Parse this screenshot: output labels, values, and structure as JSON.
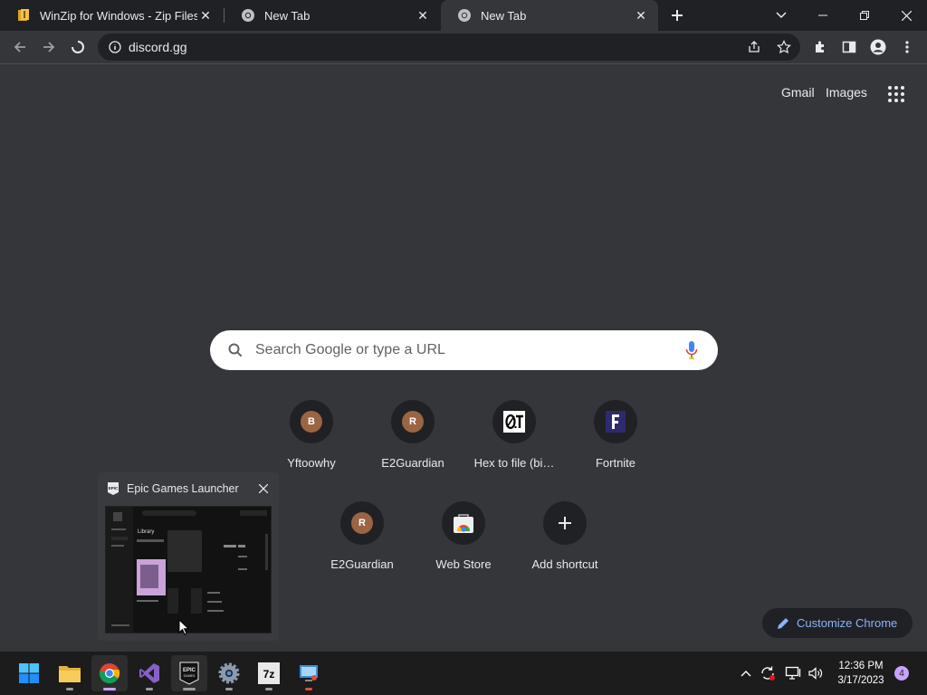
{
  "browser": {
    "tabs": [
      {
        "title": "WinZip for Windows - Zip Files, U",
        "icon": "winzip-icon",
        "active": false
      },
      {
        "title": "New Tab",
        "icon": "chrome-icon",
        "active": false
      },
      {
        "title": "New Tab",
        "icon": "chrome-icon",
        "active": true
      }
    ],
    "omnibox": {
      "url": "discord.gg"
    }
  },
  "ntp": {
    "links": {
      "gmail": "Gmail",
      "images": "Images"
    },
    "search_placeholder": "Search Google or type a URL",
    "shortcuts": [
      {
        "label": "Yftoowhy",
        "letter": "B",
        "icon": "letter-avatar"
      },
      {
        "label": "E2Guardian",
        "letter": "R",
        "icon": "letter-avatar"
      },
      {
        "label": "Hex to file (bi…",
        "letter": "",
        "icon": "hex-favicon"
      },
      {
        "label": "Fortnite",
        "letter": "",
        "icon": "fortnite-favicon"
      },
      {
        "label": "E2Guardian",
        "letter": "R",
        "icon": "letter-avatar"
      },
      {
        "label": "Web Store",
        "letter": "",
        "icon": "webstore-icon"
      },
      {
        "label": "Add shortcut",
        "letter": "",
        "icon": "plus-icon"
      }
    ],
    "customize_label": "Customize Chrome"
  },
  "preview_popup": {
    "title": "Epic Games Launcher",
    "thumb_label": "Library"
  },
  "taskbar": {
    "apps": [
      "start-icon",
      "file-explorer-icon",
      "chrome-icon",
      "visual-studio-icon",
      "epic-games-icon",
      "settings-icon",
      "7zip-icon",
      "remote-desktop-icon"
    ],
    "time": "12:36 PM",
    "date": "3/17/2023",
    "notification_count": "4"
  },
  "colors": {
    "accent": "#8ab4f8",
    "page_bg": "#35363a",
    "tab_strip": "#202124"
  }
}
